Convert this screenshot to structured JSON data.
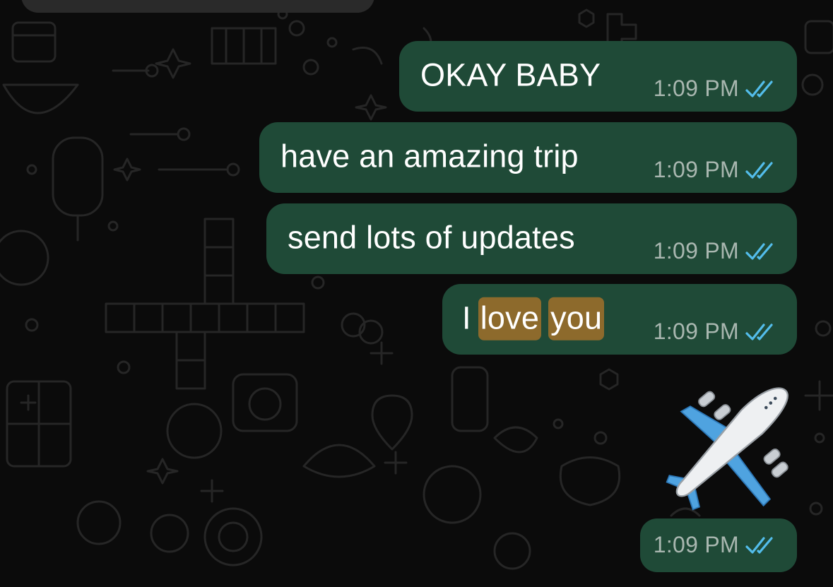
{
  "messages": [
    {
      "text": "OKAY BABY",
      "time": "1:09 PM",
      "status": "read"
    },
    {
      "text": "have an amazing trip",
      "time": "1:09 PM",
      "status": "read"
    },
    {
      "text": "send lots of updates",
      "time": "1:09 PM",
      "status": "read"
    },
    {
      "text_parts": [
        "I",
        "love",
        "you"
      ],
      "highlighted": [
        "love",
        "you"
      ],
      "time": "1:09 PM",
      "status": "read"
    },
    {
      "sticker": "airplane-emoji",
      "time": "1:09 PM",
      "status": "read"
    }
  ],
  "colors": {
    "background": "#0b0b0b",
    "outgoing_bubble": "#1f4a37",
    "timestamp": "#a9b7b0",
    "read_ticks": "#53bdeb",
    "search_highlight": "#8d6a2c"
  },
  "icons": {
    "read_receipt": "double-check-icon",
    "sticker": "airplane-icon"
  }
}
